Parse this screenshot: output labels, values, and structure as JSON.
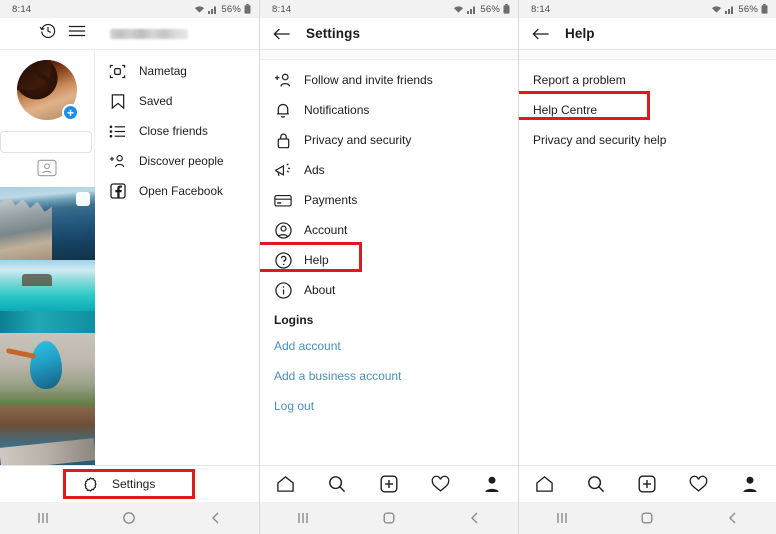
{
  "status": {
    "time": "8:14",
    "battery": "56%",
    "wifi_icon": "wifi-icon",
    "signal_icon": "signal-icon",
    "battery_icon": "battery-icon"
  },
  "panel1": {
    "name": "instagram-profile-menu",
    "history_icon": "history-clock-icon",
    "hamburger_icon": "hamburger-menu-icon",
    "username_redacted": "",
    "avatar_name": "profile-avatar",
    "add_story_icon": "plus-icon",
    "nametag_badge_icon": "nametag-badge-icon",
    "menu": [
      {
        "label": "Nametag",
        "icon": "nametag-icon"
      },
      {
        "label": "Saved",
        "icon": "bookmark-icon"
      },
      {
        "label": "Close friends",
        "icon": "list-icon"
      },
      {
        "label": "Discover people",
        "icon": "add-person-icon"
      },
      {
        "label": "Open Facebook",
        "icon": "facebook-icon"
      }
    ],
    "tabbar": {
      "heart_icon": "heart-icon",
      "profile_icon": "profile-icon",
      "settings_label": "Settings",
      "settings_icon": "settings-gear-icon"
    }
  },
  "panel2": {
    "title": "Settings",
    "back_icon": "back-arrow-icon",
    "items": [
      {
        "label": "Follow and invite friends",
        "icon": "add-person-icon"
      },
      {
        "label": "Notifications",
        "icon": "bell-icon"
      },
      {
        "label": "Privacy and security",
        "icon": "lock-icon"
      },
      {
        "label": "Ads",
        "icon": "megaphone-icon"
      },
      {
        "label": "Payments",
        "icon": "credit-card-icon"
      },
      {
        "label": "Account",
        "icon": "account-circle-icon"
      },
      {
        "label": "Help",
        "icon": "help-circle-icon",
        "highlighted": true
      },
      {
        "label": "About",
        "icon": "info-circle-icon"
      }
    ],
    "logins_title": "Logins",
    "login_links": [
      "Add account",
      "Add a business account",
      "Log out"
    ]
  },
  "panel3": {
    "title": "Help",
    "back_icon": "back-arrow-icon",
    "items": [
      {
        "label": "Report a problem",
        "highlighted": false
      },
      {
        "label": "Help Centre",
        "highlighted": true
      },
      {
        "label": "Privacy and security help",
        "highlighted": false
      }
    ]
  },
  "bottom_nav": {
    "home_icon": "home-icon",
    "search_icon": "search-icon",
    "add_icon": "add-post-icon",
    "activity_icon": "heart-icon",
    "profile_icon": "profile-icon"
  },
  "android_nav": {
    "recents_icon": "recents-icon",
    "home_icon": "home-circle-icon",
    "back_icon": "back-chevron-icon"
  },
  "colors": {
    "highlight": "#e0191c",
    "link": "#4a8fb8",
    "accent_blue": "#1c8ef3"
  }
}
